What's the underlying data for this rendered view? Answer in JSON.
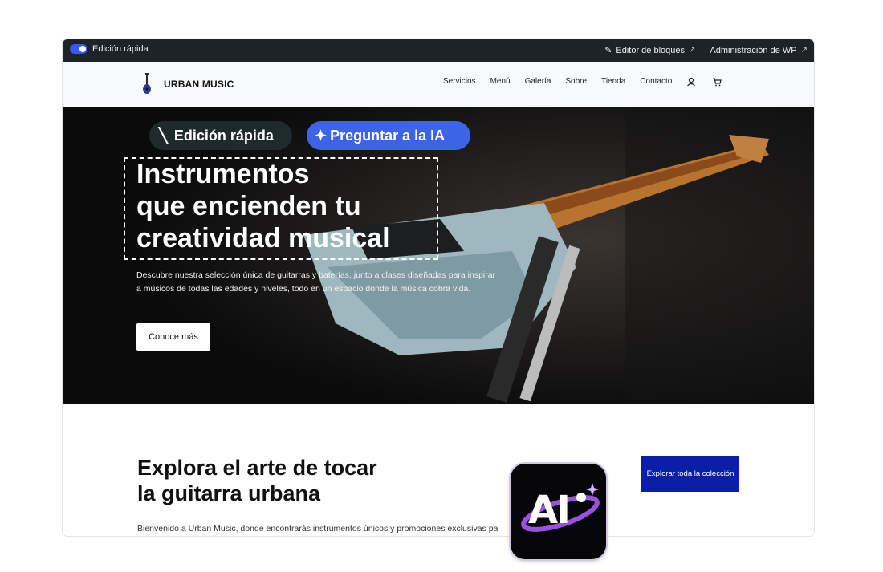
{
  "adminbar": {
    "quick_edit": "Edición rápida",
    "block_editor": "Editor de bloques",
    "wp_admin": "Administración de WP"
  },
  "site": {
    "name": "URBAN MUSIC",
    "nav": [
      "Servicios",
      "Menú",
      "Galería",
      "Sobre",
      "Tienda",
      "Contacto"
    ]
  },
  "hero": {
    "quick_edit_pill": "Edición rápida",
    "ask_ai_pill": "Preguntar a la IA",
    "title_line1": "Instrumentos",
    "title_line2": "que encienden tu",
    "title_line3": "creatividad musical",
    "description": "Descubre nuestra selección única de guitarras y baterías, junto a clases diseñadas para inspirar a músicos de todas las edades y niveles, todo en un espacio donde la música cobra vida.",
    "cta": "Conoce más"
  },
  "section": {
    "title_line1": "Explora el arte de tocar",
    "title_line2": "la guitarra urbana",
    "intro": "Bienvenido a Urban Music, donde encontrarás instrumentos únicos y promociones exclusivas pa",
    "button": "Explorar toda la colección"
  },
  "badge": {
    "text": "AI"
  },
  "colors": {
    "accent": "#3d63e6",
    "button_blue": "#0a1ea8",
    "adminbar": "#1d2327"
  }
}
